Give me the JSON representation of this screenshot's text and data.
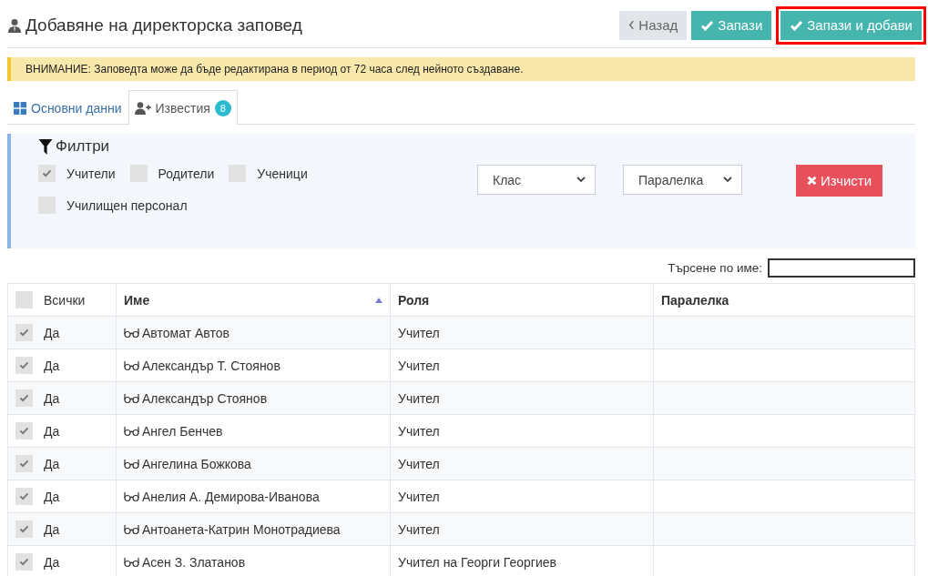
{
  "page": {
    "title": "Добавяне на директорска заповед"
  },
  "buttons": [
    {
      "kind": "back",
      "label": "Назад",
      "highlighted": false
    },
    {
      "kind": "save",
      "label": "Запази",
      "highlighted": false
    },
    {
      "kind": "save",
      "label": "Запази и добави",
      "highlighted": true
    }
  ],
  "warning": "ВНИМАНИЕ: Заповедта може да бъде редактирана в период от 72 часа след нейното създаване.",
  "tabs": [
    {
      "label": "Основни данни",
      "selected": false
    },
    {
      "label": "Известия",
      "badge": "8",
      "selected": true
    }
  ],
  "filters": {
    "title": "Филтри",
    "checkboxes": [
      {
        "label": "Учители",
        "checked": true
      },
      {
        "label": "Родители",
        "checked": false
      },
      {
        "label": "Ученици",
        "checked": false
      },
      {
        "label": "Училищен персонал",
        "checked": false
      }
    ],
    "selects": [
      {
        "value": "Клас"
      },
      {
        "value": "Паралелка"
      }
    ],
    "clear_button": "Изчисти"
  },
  "search": {
    "label": "Търсене по име:"
  },
  "table": {
    "columns": [
      {
        "label": "Всички",
        "kind": "select-all",
        "checked": false
      },
      {
        "label": "Име",
        "kind": "text",
        "sorted": true
      },
      {
        "label": "Роля",
        "kind": "text",
        "sorted": false
      },
      {
        "label": "Паралелка",
        "kind": "text",
        "sorted": false
      }
    ],
    "rows": [
      {
        "checked": true,
        "check_label": "Да",
        "name": "Автомат Автов",
        "role": "Учител"
      },
      {
        "checked": true,
        "check_label": "Да",
        "name": "Александър Т. Стоянов",
        "role": "Учител"
      },
      {
        "checked": true,
        "check_label": "Да",
        "name": "Александър Стоянов",
        "role": "Учител"
      },
      {
        "checked": true,
        "check_label": "Да",
        "name": "Ангел Бенчев",
        "role": "Учител"
      },
      {
        "checked": true,
        "check_label": "Да",
        "name": "Ангелина Божкова",
        "role": "Учител"
      },
      {
        "checked": true,
        "check_label": "Да",
        "name": "Анелия А. Демирова-Иванова",
        "role": "Учител"
      },
      {
        "checked": true,
        "check_label": "Да",
        "name": "Антоанета-Катрин Монотрадиева",
        "role": "Учител"
      },
      {
        "checked": true,
        "check_label": "Да",
        "name": "Асен З. Златанов",
        "role": "Учител на Георги Георгиев"
      }
    ]
  }
}
